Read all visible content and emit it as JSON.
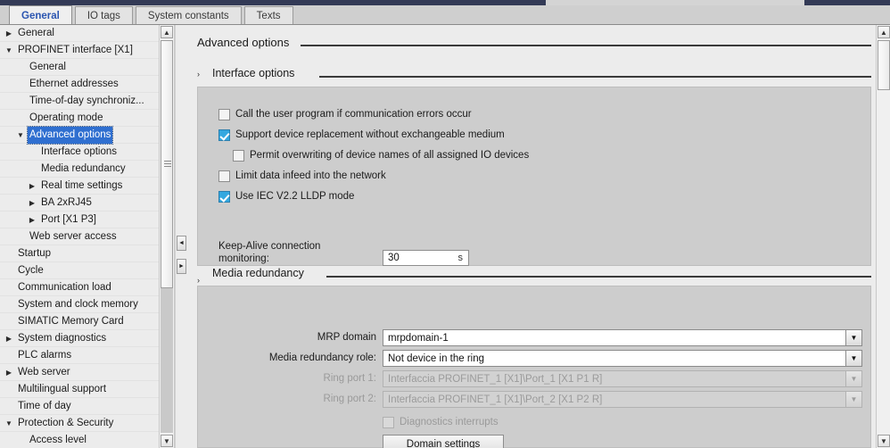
{
  "window": {
    "accent_navy": "#333a56",
    "panel_bg": "#cdcdcd",
    "page_bg": "#ececec",
    "selection_blue": "#2f6fd0",
    "checkbox_blue": "#33a8e0",
    "active_tab_text": "#2b55b0"
  },
  "tabs": [
    {
      "label": "General",
      "active": true
    },
    {
      "label": "IO tags",
      "active": false
    },
    {
      "label": "System constants",
      "active": false
    },
    {
      "label": "Texts",
      "active": false
    }
  ],
  "tree": {
    "items": [
      {
        "label": "General",
        "indent": 0,
        "twist": "collapsed",
        "selected": false
      },
      {
        "label": "PROFINET interface [X1]",
        "indent": 0,
        "twist": "expanded",
        "selected": false
      },
      {
        "label": "General",
        "indent": 1,
        "twist": "none",
        "selected": false
      },
      {
        "label": "Ethernet addresses",
        "indent": 1,
        "twist": "none",
        "selected": false
      },
      {
        "label": "Time-of-day synchroniz...",
        "indent": 1,
        "twist": "none",
        "selected": false
      },
      {
        "label": "Operating mode",
        "indent": 1,
        "twist": "none",
        "selected": false
      },
      {
        "label": "Advanced options",
        "indent": 1,
        "twist": "expanded",
        "selected": true
      },
      {
        "label": "Interface options",
        "indent": 2,
        "twist": "none",
        "selected": false
      },
      {
        "label": "Media redundancy",
        "indent": 2,
        "twist": "none",
        "selected": false
      },
      {
        "label": "Real time settings",
        "indent": 2,
        "twist": "collapsed",
        "selected": false
      },
      {
        "label": "BA 2xRJ45",
        "indent": 2,
        "twist": "collapsed",
        "selected": false
      },
      {
        "label": "Port [X1 P3]",
        "indent": 2,
        "twist": "collapsed",
        "selected": false
      },
      {
        "label": "Web server access",
        "indent": 1,
        "twist": "none",
        "selected": false
      },
      {
        "label": "Startup",
        "indent": 0,
        "twist": "none",
        "selected": false
      },
      {
        "label": "Cycle",
        "indent": 0,
        "twist": "none",
        "selected": false
      },
      {
        "label": "Communication load",
        "indent": 0,
        "twist": "none",
        "selected": false
      },
      {
        "label": "System and clock memory",
        "indent": 0,
        "twist": "none",
        "selected": false
      },
      {
        "label": "SIMATIC Memory Card",
        "indent": 0,
        "twist": "none",
        "selected": false
      },
      {
        "label": "System diagnostics",
        "indent": 0,
        "twist": "collapsed",
        "selected": false
      },
      {
        "label": "PLC alarms",
        "indent": 0,
        "twist": "none",
        "selected": false
      },
      {
        "label": "Web server",
        "indent": 0,
        "twist": "collapsed",
        "selected": false
      },
      {
        "label": "Multilingual support",
        "indent": 0,
        "twist": "none",
        "selected": false
      },
      {
        "label": "Time of day",
        "indent": 0,
        "twist": "none",
        "selected": false
      },
      {
        "label": "Protection & Security",
        "indent": 0,
        "twist": "expanded",
        "selected": false
      },
      {
        "label": "Access level",
        "indent": 1,
        "twist": "none",
        "selected": false
      }
    ],
    "scrollbar": {
      "up_glyph": "▲",
      "down_glyph": "▼"
    },
    "splitter": {
      "left_glyph": "◄",
      "right_glyph": "►"
    }
  },
  "main": {
    "page_title": "Advanced options",
    "interface_options": {
      "heading": "Interface options",
      "arrow": "›",
      "checkboxes": [
        {
          "label": "Call the user program if communication errors occur",
          "checked": false,
          "indent": 0,
          "disabled": false
        },
        {
          "label": "Support device replacement without exchangeable medium",
          "checked": true,
          "indent": 0,
          "disabled": false
        },
        {
          "label": "Permit overwriting of device names of all assigned IO devices",
          "checked": false,
          "indent": 1,
          "disabled": false
        },
        {
          "label": "Limit data infeed into the network",
          "checked": false,
          "indent": 0,
          "disabled": false
        },
        {
          "label": "Use IEC V2.2 LLDP mode",
          "checked": true,
          "indent": 0,
          "disabled": false
        }
      ],
      "keep_alive": {
        "label_line1": "Keep-Alive connection",
        "label_line2": "monitoring:",
        "value": "30",
        "unit": "s"
      }
    },
    "media_redundancy": {
      "heading": "Media redundancy",
      "arrow": "›",
      "fields": [
        {
          "label": "MRP domain",
          "value": "mrpdomain-1",
          "disabled": false
        },
        {
          "label": "Media redundancy role:",
          "value": "Not device in the ring",
          "disabled": false
        },
        {
          "label": "Ring port 1:",
          "value": "Interfaccia PROFINET_1 [X1]\\Port_1 [X1 P1 R]",
          "disabled": true
        },
        {
          "label": "Ring port 2:",
          "value": "Interfaccia PROFINET_1 [X1]\\Port_2 [X1 P2 R]",
          "disabled": true
        }
      ],
      "diagnostics_checkbox": {
        "label": "Diagnostics interrupts",
        "checked": false,
        "disabled": true
      },
      "domain_settings_button": "Domain settings",
      "dropdown_glyph": "▼"
    }
  }
}
